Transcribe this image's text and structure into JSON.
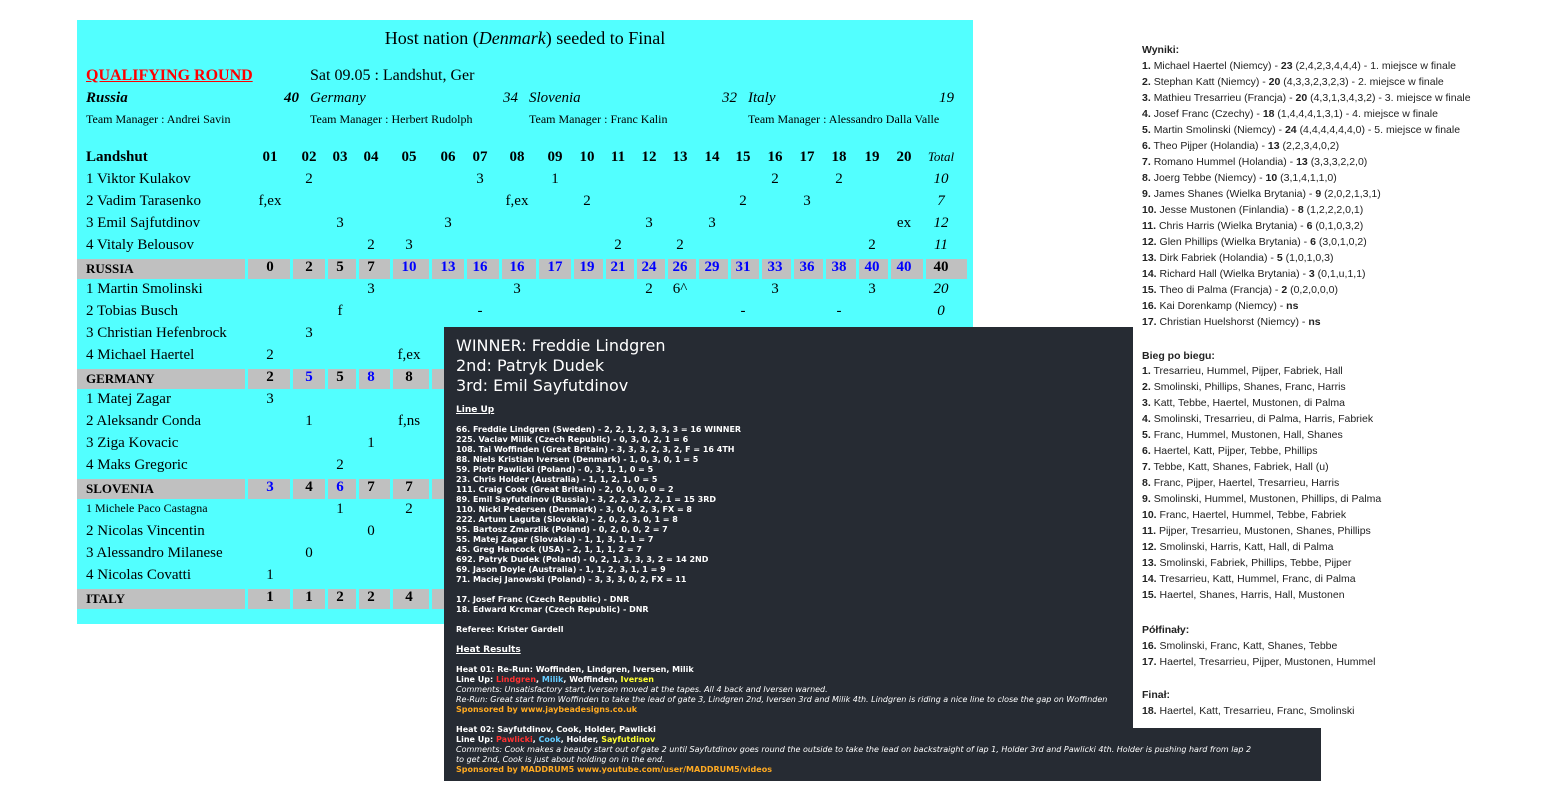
{
  "cyan": {
    "title_prefix": "Host nation (",
    "title_country": "Denmark",
    "title_suffix": ") seeded to Final",
    "round": "QUALIFYING ROUND",
    "date": "Sat 09.05 : Landshut, Ger",
    "teams": [
      {
        "name": "Russia",
        "score": "40",
        "manager": "Team Manager : Andrei Savin"
      },
      {
        "name": "Germany",
        "score": "34",
        "manager": "Team Manager : Herbert Rudolph"
      },
      {
        "name": "Slovenia",
        "score": "32",
        "manager": "Team Manager : Franc Kalin"
      },
      {
        "name": "Italy",
        "score": "19",
        "manager": "Team Manager : Alessandro Dalla Valle"
      }
    ],
    "venue": "Landshut",
    "heats": [
      "01",
      "02",
      "03",
      "04",
      "05",
      "06",
      "07",
      "08",
      "09",
      "10",
      "11",
      "12",
      "13",
      "14",
      "15",
      "16",
      "17",
      "18",
      "19",
      "20"
    ],
    "total_label": "Total",
    "rows": [
      {
        "type": "player",
        "name": "1 Viktor Kulakov",
        "cells": [
          "",
          "2",
          "",
          "",
          "",
          "",
          "3",
          "",
          "1",
          "",
          "",
          "",
          "",
          "",
          "",
          "2",
          "",
          "2",
          "",
          "",
          ""
        ],
        "total": "10"
      },
      {
        "type": "player",
        "name": "2 Vadim Tarasenko",
        "cells": [
          "f,ex",
          "",
          "",
          "",
          "",
          "",
          "",
          "f,ex",
          "",
          "2",
          "",
          "",
          "",
          "",
          "2",
          "",
          "3",
          "",
          "",
          "",
          ""
        ],
        "total": "7"
      },
      {
        "type": "player",
        "name": "3 Emil Sajfutdinov",
        "cells": [
          "",
          "",
          "3",
          "",
          "",
          "3",
          "",
          "",
          "",
          "",
          "",
          "3",
          "",
          "3",
          "",
          "",
          "",
          "",
          "",
          "ex",
          ""
        ],
        "total": "12"
      },
      {
        "type": "player",
        "name": "4 Vitaly Belousov",
        "cells": [
          "",
          "",
          "",
          "2",
          "3",
          "",
          "",
          "",
          "",
          "",
          "2",
          "",
          "2",
          "",
          "",
          "",
          "",
          "",
          "2",
          "",
          ""
        ],
        "total": "11"
      },
      {
        "type": "team",
        "name": "RUSSIA",
        "cells": [
          "0",
          "2",
          "5",
          "7",
          "10",
          "13",
          "16",
          "16",
          "17",
          "19",
          "21",
          "24",
          "26",
          "29",
          "31",
          "33",
          "36",
          "38",
          "40",
          "40"
        ],
        "blue_from": 4,
        "total": "40"
      },
      {
        "type": "player",
        "name": "1 Martin Smolinski",
        "cells": [
          "",
          "",
          "",
          "3",
          "",
          "",
          "",
          "3",
          "",
          "",
          "",
          "2",
          "6^",
          "",
          "",
          "3",
          "",
          "",
          "3",
          "",
          ""
        ],
        "total": "20"
      },
      {
        "type": "player",
        "name": "2 Tobias Busch",
        "cells": [
          "",
          "",
          "f",
          "",
          "",
          "",
          "-",
          "",
          "",
          "",
          "",
          "",
          "",
          "",
          "-",
          "",
          "",
          "-",
          "",
          "",
          ""
        ],
        "total": "0"
      },
      {
        "type": "player",
        "name": "3 Christian Hefenbrock",
        "cells": [
          "",
          "3",
          "",
          "",
          "",
          "",
          "",
          "",
          "",
          "",
          "",
          "",
          "",
          "",
          "",
          "",
          "",
          "",
          "",
          "",
          ""
        ],
        "total": ""
      },
      {
        "type": "player",
        "name": "4 Michael Haertel",
        "cells": [
          "2",
          "",
          "",
          "",
          "f,ex",
          "",
          "",
          "",
          "",
          "",
          "",
          "",
          "",
          "",
          "",
          "",
          "",
          "",
          "",
          "",
          ""
        ],
        "total": ""
      },
      {
        "type": "team",
        "name": "GERMANY",
        "cells": [
          "2",
          "5",
          "5",
          "8",
          "8",
          "",
          "",
          "",
          "",
          "",
          "",
          "",
          "",
          "",
          "",
          "",
          "",
          "",
          "",
          ""
        ],
        "blue_idx": [
          1,
          3
        ],
        "total": ""
      },
      {
        "type": "player",
        "name": "1 Matej Zagar",
        "cells": [
          "3",
          "",
          "",
          "",
          "",
          "",
          "",
          "",
          "",
          "",
          "",
          "",
          "",
          "",
          "",
          "",
          "",
          "",
          "",
          "",
          ""
        ],
        "total": ""
      },
      {
        "type": "player",
        "name": "2 Aleksandr Conda",
        "cells": [
          "",
          "1",
          "",
          "",
          "f,ns",
          "",
          "",
          "",
          "",
          "",
          "",
          "",
          "",
          "",
          "",
          "",
          "",
          "",
          "",
          "",
          ""
        ],
        "total": ""
      },
      {
        "type": "player",
        "name": "3 Ziga Kovacic",
        "cells": [
          "",
          "",
          "",
          "1",
          "",
          "",
          "",
          "",
          "",
          "",
          "",
          "",
          "",
          "",
          "",
          "",
          "",
          "",
          "",
          "",
          ""
        ],
        "total": ""
      },
      {
        "type": "player",
        "name": "4 Maks Gregoric",
        "cells": [
          "",
          "",
          "2",
          "",
          "",
          "",
          "",
          "",
          "",
          "",
          "",
          "",
          "",
          "",
          "",
          "",
          "",
          "",
          "",
          "",
          ""
        ],
        "total": ""
      },
      {
        "type": "team",
        "name": "SLOVENIA",
        "cells": [
          "3",
          "4",
          "6",
          "7",
          "7",
          "",
          "",
          "",
          "",
          "",
          "",
          "",
          "",
          "",
          "",
          "",
          "",
          "",
          "",
          ""
        ],
        "blue_idx": [
          0,
          2
        ],
        "total": ""
      },
      {
        "type": "player",
        "name": "1 Michele Paco Castagna",
        "small": true,
        "cells": [
          "",
          "",
          "1",
          "",
          "2",
          "",
          "",
          "",
          "",
          "",
          "",
          "",
          "",
          "",
          "",
          "",
          "",
          "",
          "",
          "",
          ""
        ],
        "total": ""
      },
      {
        "type": "player",
        "name": "2 Nicolas Vincentin",
        "cells": [
          "",
          "",
          "",
          "0",
          "",
          "",
          "",
          "",
          "",
          "",
          "",
          "",
          "",
          "",
          "",
          "",
          "",
          "",
          "",
          "",
          ""
        ],
        "total": ""
      },
      {
        "type": "player",
        "name": "3 Alessandro Milanese",
        "cells": [
          "",
          "0",
          "",
          "",
          "",
          "",
          "",
          "",
          "",
          "",
          "",
          "",
          "",
          "",
          "",
          "",
          "",
          "",
          "",
          "",
          ""
        ],
        "total": ""
      },
      {
        "type": "player",
        "name": "4 Nicolas Covatti",
        "cells": [
          "1",
          "",
          "",
          "",
          "",
          "",
          "",
          "",
          "",
          "",
          "",
          "",
          "",
          "",
          "",
          "",
          "",
          "",
          "",
          "",
          ""
        ],
        "total": ""
      },
      {
        "type": "team",
        "name": "ITALY",
        "cells": [
          "1",
          "1",
          "2",
          "2",
          "4",
          "",
          "",
          "",
          "",
          "",
          "",
          "",
          "",
          "",
          "",
          "",
          "",
          "",
          "",
          ""
        ],
        "total": ""
      }
    ]
  },
  "dark": {
    "winner": "WINNER: Freddie Lindgren",
    "second": "2nd: Patryk Dudek",
    "third": "3rd: Emil Sayfutdinov",
    "lineup_title": "Line Up",
    "lineup": [
      "66. Freddie Lindgren (Sweden) - 2, 2, 1, 2, 3, 3, 3 = 16 WINNER",
      "225. Vaclav Milik (Czech Republic) - 0, 3, 0, 2, 1 = 6",
      "108. Tai Woffinden (Great Britain) - 3, 3, 3, 2, 3, 2, F = 16 4TH",
      "88. Niels Kristian Iversen (Denmark) - 1, 0, 3, 0, 1 = 5",
      "59. Piotr Pawlicki (Poland) - 0, 3, 1, 1, 0 = 5",
      "23. Chris Holder (Australia) - 1, 1, 2, 1, 0 = 5",
      "111. Craig Cook (Great Britain) - 2, 0, 0, 0, 0 = 2",
      "89. Emil Sayfutdinov (Russia) - 3, 2, 2, 3, 2, 2, 1 = 15 3RD",
      "110. Nicki Pedersen (Denmark) - 3, 0, 0, 2, 3, FX = 8",
      "222. Artum Laguta (Slovakia) - 2, 0, 2, 3, 0, 1 = 8",
      "95. Bartosz Zmarzlik (Poland) - 0, 2, 0, 0, 2 = 7",
      "55. Matej Zagar (Slovakia) - 1, 1, 3, 1, 1 = 7",
      "45. Greg Hancock (USA) - 2, 1, 1, 1, 2 = 7",
      "692. Patryk Dudek (Poland) - 0, 2, 1, 3, 3, 3, 2 = 14 2ND",
      "69. Jason Doyle (Australia) - 1, 1, 2, 3, 1, 1 = 9",
      "71. Maciej Janowski (Poland) - 3, 3, 3, 0, 2, FX = 11"
    ],
    "dnr": [
      "17. Josef Franc (Czech Republic) - DNR",
      "18. Edward Krcmar (Czech Republic) - DNR"
    ],
    "referee": "Referee: Krister Gardell",
    "heat_results_title": "Heat Results",
    "heat1_title": "Heat 01: Re-Run: Woffinden, Lindgren, Iversen, Milik",
    "lineup_label": "Line Up:",
    "heat1_riders": [
      "Lindgren",
      "Milik",
      "Woffinden",
      "Iversen"
    ],
    "heat1_comment1": "Comments: Unsatisfactory start, Iversen moved at the tapes. All 4 back and Iversen warned.",
    "heat1_comment2": "Re-Run: Great start from Woffinden to take the lead of gate 3, Lindgren 2nd, Iversen 3rd and Milik 4th. Lindgren is riding a nice line to close the gap on Woffinden",
    "sponsored_by": "Sponsored by",
    "heat1_sponsor": "www.jaybeadesigns.co.uk",
    "heat2_title": "Heat 02: Sayfutdinov, Cook, Holder, Pawlicki",
    "heat2_riders": [
      "Pawlicki",
      "Cook",
      "Holder",
      "Sayfutdinov"
    ],
    "heat2_comment1": "Comments: Cook makes a beauty start out of gate 2 until Sayfutdinov goes round the outside to take the lead on backstraight of lap 1, Holder 3rd and Pawlicki 4th. Holder is pushing hard from lap 2",
    "heat2_comment2": "to get 2nd, Cook is just about holding on in the end.",
    "heat2_sponsor_name": "MADDRUM5",
    "heat2_sponsor_url": "www.youtube.com/user/MADDRUM5/videos"
  },
  "wyniki": {
    "title": "Wyniki:",
    "results": [
      {
        "n": "1.",
        "name": "Michael Haertel (Niemcy) -",
        "pts": "23",
        "rest": "(2,4,2,3,4,4,4) - 1. miejsce w finale"
      },
      {
        "n": "2.",
        "name": "Stephan Katt (Niemcy) -",
        "pts": "20",
        "rest": "(4,3,3,2,3,2,3) - 2. miejsce w finale"
      },
      {
        "n": "3.",
        "name": "Mathieu Tresarrieu (Francja) -",
        "pts": "20",
        "rest": "(4,3,1,3,4,3,2) - 3. miejsce w finale"
      },
      {
        "n": "4.",
        "name": "Josef Franc (Czechy) -",
        "pts": "18",
        "rest": "(1,4,4,4,1,3,1) - 4. miejsce w finale"
      },
      {
        "n": "5.",
        "name": "Martin Smolinski (Niemcy) -",
        "pts": "24",
        "rest": "(4,4,4,4,4,4,0) - 5. miejsce w finale"
      },
      {
        "n": "6.",
        "name": "Theo Pijper (Holandia) -",
        "pts": "13",
        "rest": "(2,2,3,4,0,2)"
      },
      {
        "n": "7.",
        "name": "Romano Hummel (Holandia) -",
        "pts": "13",
        "rest": "(3,3,3,2,2,0)"
      },
      {
        "n": "8.",
        "name": "Joerg Tebbe (Niemcy) -",
        "pts": "10",
        "rest": "(3,1,4,1,1,0)"
      },
      {
        "n": "9.",
        "name": "James Shanes (Wielka Brytania) -",
        "pts": "9",
        "rest": "(2,0,2,1,3,1)"
      },
      {
        "n": "10.",
        "name": "Jesse Mustonen (Finlandia) -",
        "pts": "8",
        "rest": "(1,2,2,2,0,1)"
      },
      {
        "n": "11.",
        "name": "Chris Harris (Wielka Brytania) -",
        "pts": "6",
        "rest": "(0,1,0,3,2)"
      },
      {
        "n": "12.",
        "name": "Glen Phillips (Wielka Brytania) -",
        "pts": "6",
        "rest": "(3,0,1,0,2)"
      },
      {
        "n": "13.",
        "name": "Dirk Fabriek (Holandia) -",
        "pts": "5",
        "rest": "(1,0,1,0,3)"
      },
      {
        "n": "14.",
        "name": "Richard Hall (Wielka Brytania) -",
        "pts": "3",
        "rest": "(0,1,u,1,1)"
      },
      {
        "n": "15.",
        "name": "Theo di Palma (Francja) -",
        "pts": "2",
        "rest": "(0,2,0,0,0)"
      },
      {
        "n": "16.",
        "name": "Kai Dorenkamp (Niemcy) -",
        "pts": "ns",
        "rest": ""
      },
      {
        "n": "17.",
        "name": "Christian Huelshorst (Niemcy) -",
        "pts": "ns",
        "rest": ""
      }
    ],
    "heats_title": "Bieg po biegu:",
    "heats": [
      {
        "n": "1.",
        "t": "Tresarrieu, Hummel, Pijper, Fabriek, Hall"
      },
      {
        "n": "2.",
        "t": "Smolinski, Phillips, Shanes, Franc, Harris"
      },
      {
        "n": "3.",
        "t": "Katt, Tebbe, Haertel, Mustonen, di Palma"
      },
      {
        "n": "4.",
        "t": "Smolinski, Tresarrieu, di Palma, Harris, Fabriek"
      },
      {
        "n": "5.",
        "t": "Franc, Hummel, Mustonen, Hall, Shanes"
      },
      {
        "n": "6.",
        "t": "Haertel, Katt, Pijper, Tebbe, Phillips"
      },
      {
        "n": "7.",
        "t": "Tebbe, Katt, Shanes, Fabriek, Hall (u)"
      },
      {
        "n": "8.",
        "t": "Franc, Pijper, Haertel, Tresarrieu, Harris"
      },
      {
        "n": "9.",
        "t": "Smolinski, Hummel, Mustonen, Phillips, di Palma"
      },
      {
        "n": "10.",
        "t": "Franc, Haertel, Hummel, Tebbe, Fabriek"
      },
      {
        "n": "11.",
        "t": "Pijper, Tresarrieu, Mustonen, Shanes, Phillips"
      },
      {
        "n": "12.",
        "t": "Smolinski, Harris, Katt, Hall, di Palma"
      },
      {
        "n": "13.",
        "t": "Smolinski, Fabriek, Phillips, Tebbe, Pijper"
      },
      {
        "n": "14.",
        "t": "Tresarrieu, Katt, Hummel, Franc, di Palma"
      },
      {
        "n": "15.",
        "t": "Haertel, Shanes, Harris, Hall, Mustonen"
      }
    ],
    "semis_title": "Półfinały:",
    "semis": [
      {
        "n": "16.",
        "t": "Smolinski, Franc, Katt, Shanes, Tebbe"
      },
      {
        "n": "17.",
        "t": "Haertel, Tresarrieu, Pijper, Mustonen, Hummel"
      }
    ],
    "final_title": "Finał:",
    "final": [
      {
        "n": "18.",
        "t": "Haertel, Katt, Tresarrieu, Franc, Smolinski"
      }
    ]
  }
}
